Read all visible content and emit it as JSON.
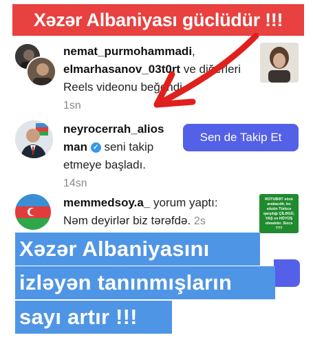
{
  "banners": {
    "top": "Xəzər Albaniyası güclüdür !!!",
    "caption_line1": "Xəzər Albaniyasını",
    "caption_line2": "izləyən tanınmışların",
    "caption_line3": "sayı artır !!!"
  },
  "notifications": [
    {
      "user1": "nemat_purmohammadi",
      "user2": "elmarhasanov_03t0rt",
      "action": "ve diğerleri Reels videonu beğendi.",
      "time": "1sn"
    },
    {
      "user_line1": "neyrocerrah_alios",
      "user_line2": "man",
      "action_line1": "seni takip",
      "action_line2": "etmeye başladı.",
      "time": "14sn",
      "button": "Sen de Takip Et"
    },
    {
      "user": "memmedsoy.a_",
      "action": "yorum yaptı:",
      "comment": "Nəm deyirlər biz tərəfdə.",
      "time": "2s",
      "thumb_text": "RÜTUBƏT sözü arabacdir, bu sözün Türkcə qarşılığı ÇİLƏGÜ, YAŞ və HÖYÜŞ olmalıdır. Sizcə ???"
    }
  ],
  "icons": {
    "verified": "verified-badge-icon",
    "arrow": "red-arrow-annotation"
  },
  "colors": {
    "top_banner": "#e8413f",
    "caption": "#4f95e6",
    "button": "#5560e8",
    "arrow": "#e0201c"
  }
}
